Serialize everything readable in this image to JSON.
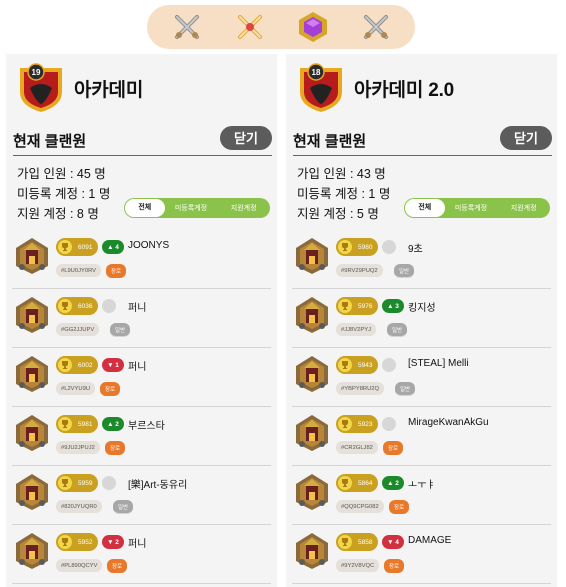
{
  "nav": {
    "items": [
      {
        "name": "crossed-swords-icon"
      },
      {
        "name": "crossed-swords-gold-icon"
      },
      {
        "name": "hexagon-gem-icon"
      },
      {
        "name": "crossed-swords-icon"
      }
    ]
  },
  "colors": {
    "accent_green": "#8bc34a",
    "trophy_gold": "#c9a020",
    "leader_orange": "#e8782a",
    "member_gray": "#a7a7a7",
    "up_green": "#1a8a2a",
    "down_red": "#d23040"
  },
  "clans": [
    {
      "badge_level": "19",
      "name": "아카데미",
      "section_title": "현재 클랜원",
      "close_label": "닫기",
      "stats": {
        "members": "가입 인원 : 45 명",
        "unregistered": "미등록 계정 : 1 명",
        "applicants": "지원 계정 : 8 명"
      },
      "filters": [
        "전체",
        "미등록계정",
        "지원계정"
      ],
      "members": [
        {
          "trophies": "6091",
          "change": "4",
          "dir": "up",
          "name": "JOONYS",
          "tag": "#L9U0JY0RV",
          "role": "장로",
          "role_type": "leader"
        },
        {
          "trophies": "6036",
          "change": "",
          "dir": "none",
          "name": "퍼니",
          "tag": "#GG2JJUPV",
          "role": "일반",
          "role_type": "member"
        },
        {
          "trophies": "6002",
          "change": "1",
          "dir": "down",
          "name": "퍼니",
          "tag": "#L2VYU9U",
          "role": "장로",
          "role_type": "leader"
        },
        {
          "trophies": "5981",
          "change": "2",
          "dir": "up",
          "name": "부르스타",
          "tag": "#9JU2JPUJ2",
          "role": "장로",
          "role_type": "leader"
        },
        {
          "trophies": "5959",
          "change": "",
          "dir": "none",
          "name": "[樂]Art-동유리",
          "tag": "#820JYUQR0",
          "role": "일반",
          "role_type": "member"
        },
        {
          "trophies": "5952",
          "change": "2",
          "dir": "down",
          "name": "퍼니",
          "tag": "#PL890QCYV",
          "role": "장로",
          "role_type": "leader"
        }
      ]
    },
    {
      "badge_level": "18",
      "name": "아카데미 2.0",
      "section_title": "현재 클랜원",
      "close_label": "닫기",
      "stats": {
        "members": "가입 인원 : 43 명",
        "unregistered": "미등록 계정 : 1 명",
        "applicants": "지원 계정 : 5 명"
      },
      "filters": [
        "전체",
        "미등록계정",
        "지원계정"
      ],
      "members": [
        {
          "trophies": "5980",
          "change": "",
          "dir": "none",
          "name": "9초",
          "tag": "#9RV29PUQ2",
          "role": "일반",
          "role_type": "member"
        },
        {
          "trophies": "5976",
          "change": "3",
          "dir": "up",
          "name": "킹지성",
          "tag": "#JJ8V2PYJ",
          "role": "일반",
          "role_type": "member"
        },
        {
          "trophies": "5943",
          "change": "",
          "dir": "none",
          "name": "[STEAL] Melli",
          "tag": "#YBPY8RU2Q",
          "role": "일반",
          "role_type": "member"
        },
        {
          "trophies": "5923",
          "change": "",
          "dir": "none",
          "name": "MirageKwanAkGu",
          "tag": "#CR2GLJ82",
          "role": "장로",
          "role_type": "leader"
        },
        {
          "trophies": "5864",
          "change": "2",
          "dir": "up",
          "name": "ㅗㅜㅑ",
          "tag": "#QQ9CPG082",
          "role": "장로",
          "role_type": "leader"
        },
        {
          "trophies": "5858",
          "change": "4",
          "dir": "down",
          "name": "DAMAGE",
          "tag": "#9Y2V8VQC",
          "role": "장로",
          "role_type": "leader"
        }
      ]
    }
  ]
}
